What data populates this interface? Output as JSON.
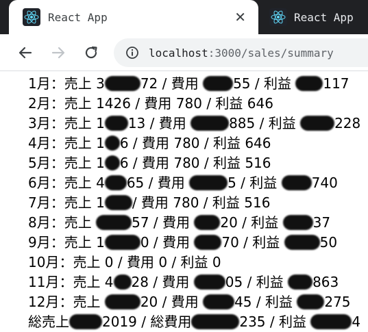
{
  "browser": {
    "tabs": [
      {
        "title": "React App",
        "active": true
      },
      {
        "title": "React App",
        "active": false
      }
    ],
    "close_glyph": "✕",
    "url_host": "localhost",
    "url_rest": ":3000/sales/summary",
    "icons": {
      "back": "arrow-left-icon",
      "forward": "arrow-right-icon",
      "reload": "reload-icon",
      "info": "info-icon",
      "favicon": "react-logo-icon"
    },
    "colors": {
      "tabstrip": "#202124",
      "react": "#61dafb"
    }
  },
  "summary": {
    "rows": [
      {
        "label": "1月：",
        "parts": [
          "売上 ",
          "",
          " / 費用 ",
          "",
          " / 利益 ",
          ""
        ],
        "note": "values redacted"
      },
      {
        "label": "2月：",
        "text": "2月：売上 1426 / 費用 780 / 利益 646"
      },
      {
        "label": "3月：",
        "text": "3月：売上 "
      },
      {
        "label": "4月：",
        "text": "4月：売上 1"
      },
      {
        "label": "5月：",
        "text": "5月：売上 1"
      },
      {
        "label": "6月：",
        "text": "6月：売上 4"
      },
      {
        "label": "7月：",
        "text": "7月：売上 1"
      },
      {
        "label": "8月：",
        "text": "8月：売上 "
      },
      {
        "label": "9月：",
        "text": "9月：売上 1"
      },
      {
        "label": "10月：",
        "text": "10月：売上 0 / 費用 0 / 利益 0"
      },
      {
        "label": "11月：",
        "text": "11月：売上 4"
      },
      {
        "label": "12月：",
        "text": "12月：売上 "
      },
      {
        "label": "総",
        "text": "総売上"
      }
    ],
    "line1": {
      "a": "1月：売上 3",
      "b": "72 / 費用 ",
      "c": "55 / 利益 ",
      "d": "117"
    },
    "line2": "2月：売上 1426 / 費用 780 / 利益 646",
    "line3": {
      "a": "3月：売上 1",
      "b": "13 / 費用 ",
      "c": "885 / 利益 ",
      "d": "228"
    },
    "line4": {
      "a": "4月：売上 1",
      "b": "6 / 費用 780 / 利益 646"
    },
    "line5": {
      "a": "5月：売上 1",
      "b": "6 / 費用 780 / 利益 516"
    },
    "line6": {
      "a": "6月：売上 4",
      "b": "65 / 費用 ",
      "c": "5 / 利益 ",
      "d": "740"
    },
    "line7": {
      "a": "7月：売上 1",
      "b": "/ 費用 780 / 利益 516"
    },
    "line8": {
      "a": "8月：売上 ",
      "b": "57 / 費用 ",
      "c": "20 / 利益 ",
      "d": "37"
    },
    "line9": {
      "a": "9月：売上 1",
      "b": "0 / 費用 ",
      "c": "70 / 利益 ",
      "d": "50"
    },
    "line10": "10月：売上 0 / 費用 0 / 利益 0",
    "line11": {
      "a": "11月：売上 4",
      "b": "28 / 費用 ",
      "c": "05 / 利益 ",
      "d": "863"
    },
    "line12": {
      "a": "12月：売上 ",
      "b": "20 / 費用 ",
      "c": "45 / 利益 ",
      "d": "275"
    },
    "line13": {
      "a": "総売上",
      "b": "2019 / 総費用",
      "c": "235 / 利益 ",
      "d": "4"
    }
  }
}
